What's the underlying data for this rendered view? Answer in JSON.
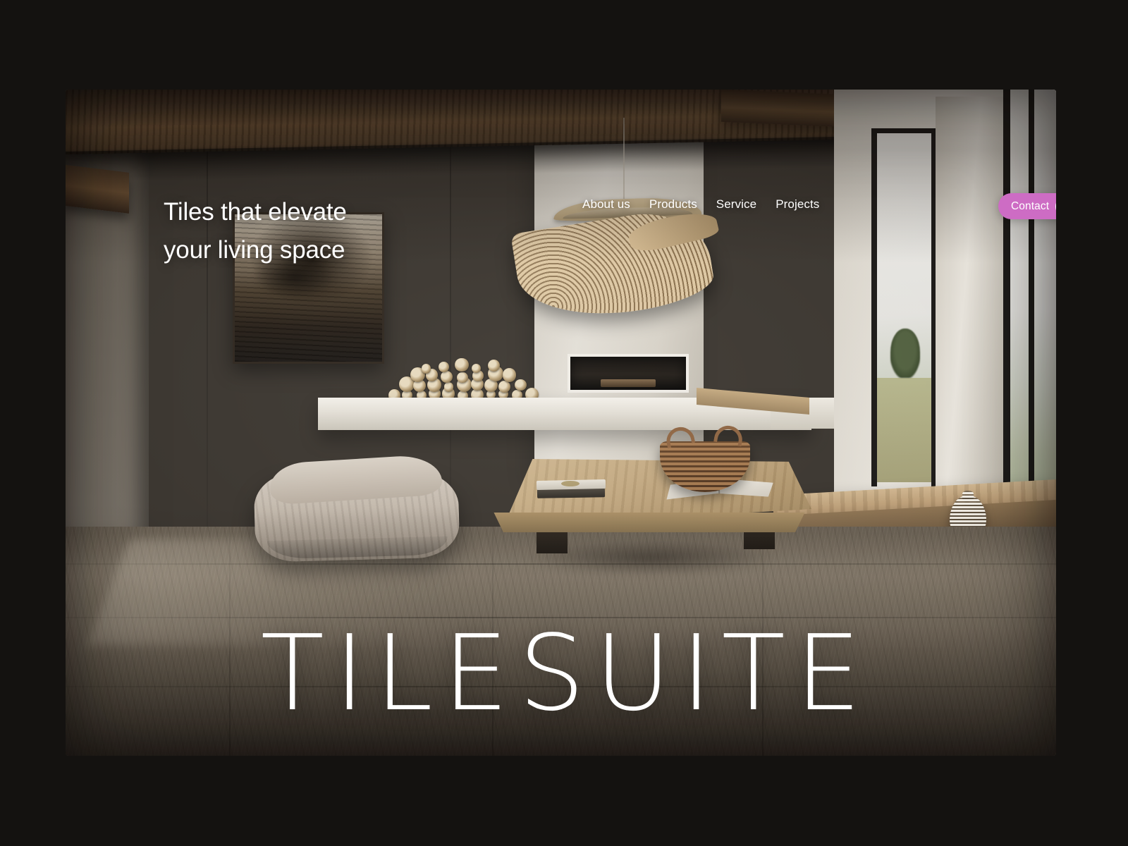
{
  "page": {
    "background_color": "#141210",
    "accent_color": "#cd6cc4"
  },
  "hero": {
    "headline": "Tiles that elevate\nyour living space",
    "brand_wordmark": "TILESUITE",
    "background_alt": "minimalist living room interior with wooden beams, rattan pendant lamp, fireplace, floor cushion and low oak coffee table"
  },
  "nav": {
    "items": [
      {
        "label": "About us"
      },
      {
        "label": "Products"
      },
      {
        "label": "Service"
      },
      {
        "label": "Projects"
      }
    ]
  },
  "contact": {
    "label": "Contact",
    "icon": "arrow-up-right-icon"
  }
}
